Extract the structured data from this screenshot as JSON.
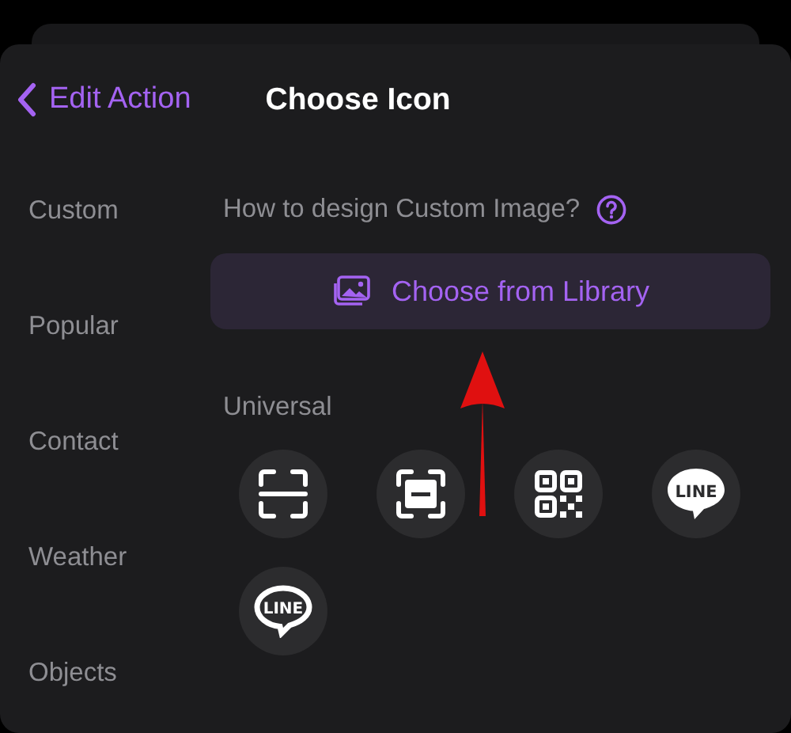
{
  "header": {
    "back_label": "Edit Action",
    "title": "Choose Icon"
  },
  "sidebar": {
    "items": [
      {
        "label": "Custom",
        "selected": false
      },
      {
        "label": "Popular",
        "selected": false
      },
      {
        "label": "Contact",
        "selected": false
      },
      {
        "label": "Weather",
        "selected": false
      },
      {
        "label": "Objects",
        "selected": false
      }
    ]
  },
  "content": {
    "hint": "How to design Custom Image?",
    "library_button": "Choose from Library",
    "section_title": "Universal",
    "icons": [
      {
        "kind": "scan"
      },
      {
        "kind": "scan-bar"
      },
      {
        "kind": "qr"
      },
      {
        "kind": "line-filled",
        "label": "LINE"
      },
      {
        "kind": "line-outline",
        "label": "LINE"
      }
    ]
  },
  "annotation": {
    "kind": "arrow"
  }
}
